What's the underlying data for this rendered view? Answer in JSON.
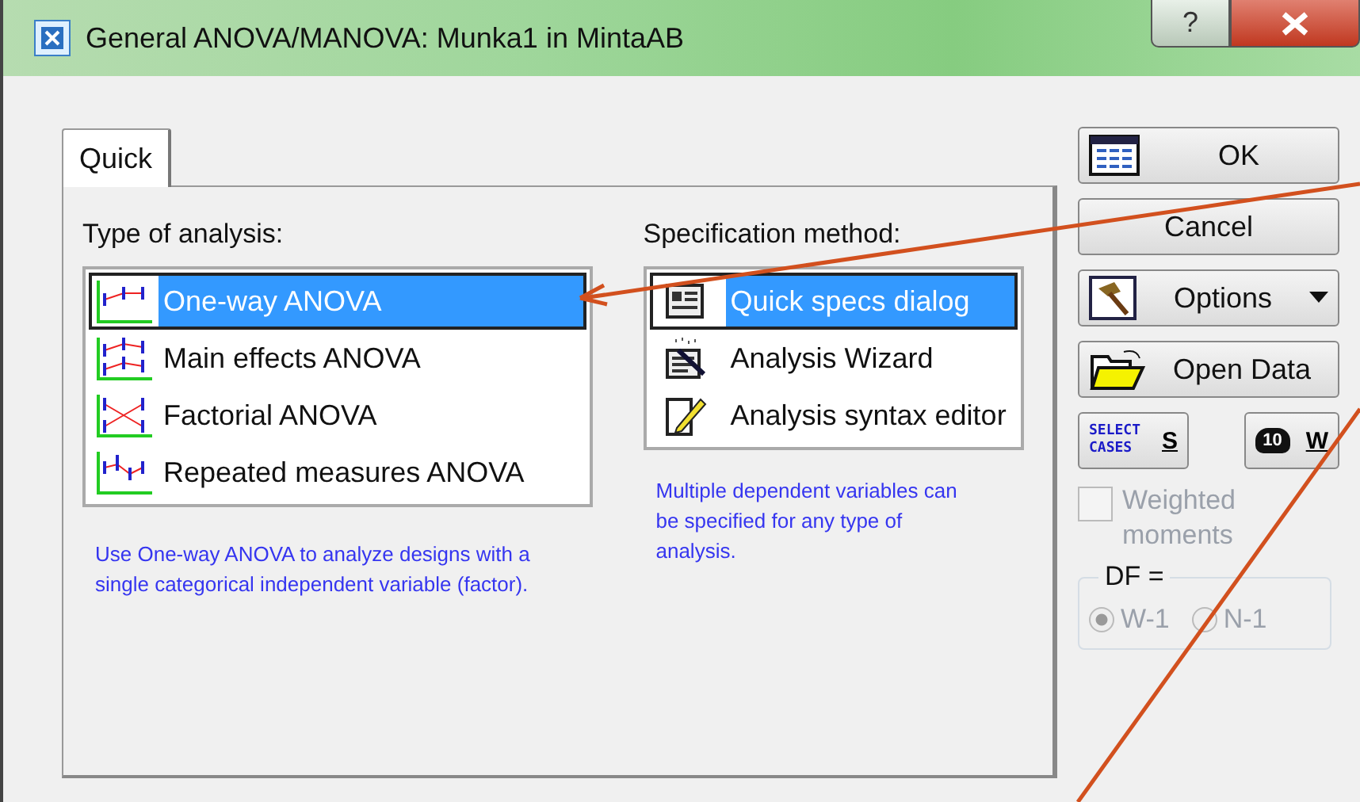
{
  "window": {
    "title": "General ANOVA/MANOVA: Munka1 in MintaAB",
    "help_label": "?"
  },
  "tabs": [
    {
      "label": "Quick",
      "selected": true
    }
  ],
  "analysis_type": {
    "label": "Type of analysis:",
    "items": [
      {
        "kind": "oneway",
        "label": "One-way ANOVA",
        "selected": true
      },
      {
        "kind": "main",
        "label": "Main effects ANOVA",
        "selected": false
      },
      {
        "kind": "factorial",
        "label": "Factorial ANOVA",
        "selected": false
      },
      {
        "kind": "repeated",
        "label": "Repeated measures ANOVA",
        "selected": false
      }
    ],
    "note": "Use One-way ANOVA to analyze designs with a single categorical independent variable (factor)."
  },
  "specification": {
    "label": "Specification method:",
    "items": [
      {
        "kind": "quick",
        "label": "Quick specs dialog",
        "selected": true
      },
      {
        "kind": "wizard",
        "label": "Analysis Wizard",
        "selected": false
      },
      {
        "kind": "syntax",
        "label": "Analysis syntax editor",
        "selected": false
      }
    ],
    "note": "Multiple dependent variables can be specified for any type of analysis."
  },
  "buttons": [
    {
      "kind": "ok",
      "label": "OK"
    },
    {
      "kind": "cancel",
      "label": "Cancel"
    },
    {
      "kind": "options",
      "label": "Options"
    },
    {
      "kind": "open",
      "label": "Open Data"
    }
  ],
  "small_buttons": [
    {
      "kind": "select",
      "icon_text": "SELECT CASES",
      "label": "S"
    },
    {
      "kind": "weight",
      "icon_text": "10",
      "label": "W"
    }
  ],
  "weighted_moments": {
    "label": "Weighted moments",
    "checked": false,
    "disabled": true
  },
  "df": {
    "label": "DF =",
    "disabled": true,
    "options": [
      {
        "label": "W-1",
        "selected": true
      },
      {
        "label": "N-1",
        "selected": false
      }
    ]
  }
}
